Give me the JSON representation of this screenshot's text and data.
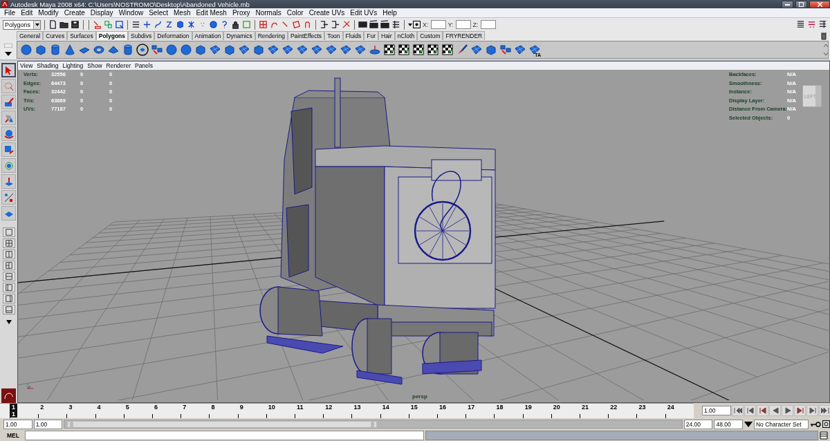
{
  "window": {
    "title": "Autodesk Maya 2008 x64: C:\\Users\\NOSTROMO\\Desktop\\Abandoned Vehicle.mb"
  },
  "menu": [
    "File",
    "Edit",
    "Modify",
    "Create",
    "Display",
    "Window",
    "Select",
    "Mesh",
    "Edit Mesh",
    "Proxy",
    "Normals",
    "Color",
    "Create UVs",
    "Edit UVs",
    "Help"
  ],
  "status_line": {
    "menu_set": "Polygons",
    "fields": [
      {
        "label": "X:"
      },
      {
        "label": "Y:"
      },
      {
        "label": "Z:"
      }
    ]
  },
  "shelf": {
    "tabs": [
      {
        "label": "General",
        "selected": false
      },
      {
        "label": "Curves",
        "selected": false
      },
      {
        "label": "Surfaces",
        "selected": false
      },
      {
        "label": "Polygons",
        "selected": true
      },
      {
        "label": "Subdivs",
        "selected": false
      },
      {
        "label": "Deformation",
        "selected": false
      },
      {
        "label": "Animation",
        "selected": false
      },
      {
        "label": "Dynamics",
        "selected": false
      },
      {
        "label": "Rendering",
        "selected": false
      },
      {
        "label": "PaintEffects",
        "selected": false
      },
      {
        "label": "Toon",
        "selected": false
      },
      {
        "label": "Fluids",
        "selected": false
      },
      {
        "label": "Fur",
        "selected": false
      },
      {
        "label": "Hair",
        "selected": false
      },
      {
        "label": "nCloth",
        "selected": false
      },
      {
        "label": "Custom",
        "selected": false
      },
      {
        "label": "FRYRENDER",
        "selected": false
      }
    ],
    "icons": [
      {
        "kind": "sphere"
      },
      {
        "kind": "cube"
      },
      {
        "kind": "cylinder"
      },
      {
        "kind": "cone"
      },
      {
        "kind": "plane"
      },
      {
        "kind": "torus"
      },
      {
        "kind": "pyramid"
      },
      {
        "kind": "cylinder"
      },
      {
        "kind": "circle"
      },
      {
        "kind": "split"
      },
      {
        "kind": "sphere"
      },
      {
        "kind": "sphere"
      },
      {
        "kind": "cube"
      },
      {
        "kind": "patch"
      },
      {
        "kind": "cube"
      },
      {
        "kind": "patch"
      },
      {
        "kind": "cube"
      },
      {
        "kind": "patch"
      },
      {
        "kind": "patch"
      },
      {
        "kind": "patch"
      },
      {
        "kind": "patch"
      },
      {
        "kind": "patch"
      },
      {
        "kind": "patch"
      },
      {
        "kind": "patch"
      },
      {
        "kind": "disc"
      },
      {
        "kind": "checker"
      },
      {
        "kind": "checker"
      },
      {
        "kind": "checker"
      },
      {
        "kind": "checker"
      },
      {
        "kind": "checker"
      },
      {
        "kind": "brush"
      },
      {
        "kind": "patch"
      },
      {
        "kind": "cube"
      },
      {
        "kind": "split"
      },
      {
        "kind": "patch"
      },
      {
        "kind": "patch",
        "label": "TA"
      }
    ]
  },
  "viewport": {
    "menu": [
      "View",
      "Shading",
      "Lighting",
      "Show",
      "Renderer",
      "Panels"
    ],
    "stats": [
      {
        "label": "Verts:",
        "values": [
          "32556",
          "0",
          "0"
        ]
      },
      {
        "label": "Edges:",
        "values": [
          "64473",
          "0",
          "0"
        ]
      },
      {
        "label": "Faces:",
        "values": [
          "32442",
          "0",
          "0"
        ]
      },
      {
        "label": "Tris:",
        "values": [
          "63869",
          "0",
          "0"
        ]
      },
      {
        "label": "UVs:",
        "values": [
          "77187",
          "0",
          "0"
        ]
      }
    ],
    "info": [
      {
        "label": "Backfaces:",
        "value": "N/A"
      },
      {
        "label": "Smoothness:",
        "value": "N/A"
      },
      {
        "label": "Instance:",
        "value": "N/A"
      },
      {
        "label": "Display Layer:",
        "value": "N/A"
      },
      {
        "label": "Distance From Camera:",
        "value": "N/A"
      },
      {
        "label": "Selected Objects:",
        "value": "0"
      }
    ],
    "view_cube": "LEFT",
    "camera": "persp"
  },
  "timeline": {
    "frames": [
      {
        "label": "1",
        "selected": true
      },
      {
        "label": "2",
        "selected": false
      },
      {
        "label": "3",
        "selected": false
      },
      {
        "label": "4",
        "selected": false
      },
      {
        "label": "5",
        "selected": false
      },
      {
        "label": "6",
        "selected": false
      },
      {
        "label": "7",
        "selected": false
      },
      {
        "label": "8",
        "selected": false
      },
      {
        "label": "9",
        "selected": false
      },
      {
        "label": "10",
        "selected": false
      },
      {
        "label": "11",
        "selected": false
      },
      {
        "label": "12",
        "selected": false
      },
      {
        "label": "13",
        "selected": false
      },
      {
        "label": "14",
        "selected": false
      },
      {
        "label": "15",
        "selected": false
      },
      {
        "label": "16",
        "selected": false
      },
      {
        "label": "17",
        "selected": false
      },
      {
        "label": "18",
        "selected": false
      },
      {
        "label": "19",
        "selected": false
      },
      {
        "label": "20",
        "selected": false
      },
      {
        "label": "21",
        "selected": false
      },
      {
        "label": "22",
        "selected": false
      },
      {
        "label": "23",
        "selected": false
      },
      {
        "label": "24",
        "selected": false
      }
    ],
    "marker": "1",
    "current_frame": "1.00"
  },
  "range": {
    "level": 0.5,
    "start": "1.00",
    "inner_start": "1.00",
    "inner_end": "24.00",
    "end": "48.00",
    "character_set": "No Character Set"
  },
  "command_line": {
    "label": "MEL"
  }
}
